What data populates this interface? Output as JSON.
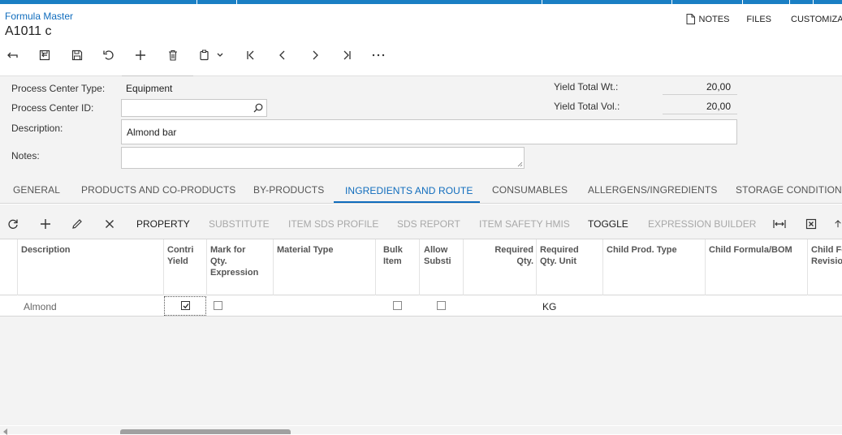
{
  "header": {
    "breadcrumb": "Formula Master",
    "title": "A1011 c",
    "links": {
      "notes": "NOTES",
      "files": "FILES",
      "customize": "CUSTOMIZATION"
    }
  },
  "toolbar": {
    "icons": [
      "back-icon",
      "cancel-changes-icon",
      "save-icon",
      "undo-icon",
      "add-icon",
      "delete-icon",
      "copy-paste-icon",
      "first-record-icon",
      "previous-record-icon",
      "next-record-icon",
      "last-record-icon",
      "more-icon"
    ]
  },
  "form": {
    "process_center_type_label": "Process Center Type:",
    "process_center_type_value": "Equipment",
    "process_center_id_label": "Process Center ID:",
    "process_center_id_value": "",
    "description_label": "Description:",
    "description_value": "Almond bar",
    "notes_label": "Notes:",
    "notes_value": "",
    "yield_total_wt_label": "Yield Total Wt.:",
    "yield_total_wt_value": "20,00",
    "yield_total_vol_label": "Yield Total Vol.:",
    "yield_total_vol_value": "20,00"
  },
  "tabs": [
    "GENERAL",
    "PRODUCTS AND CO-PRODUCTS",
    "BY-PRODUCTS",
    "INGREDIENTS AND ROUTE",
    "CONSUMABLES",
    "ALLERGENS/INGREDIENTS",
    "STORAGE CONDITIONS"
  ],
  "active_tab": "INGREDIENTS AND ROUTE",
  "gridbar": {
    "property": "PROPERTY",
    "substitute": "SUBSTITUTE",
    "item_sds_profile": "ITEM SDS PROFILE",
    "sds_report": "SDS REPORT",
    "item_safety_hmis": "ITEM SAFETY HMIS",
    "toggle": "TOGGLE",
    "expression_builder": "EXPRESSION BUILDER"
  },
  "grid": {
    "columns": {
      "description": "Description",
      "contri_yield_1": "Contri",
      "contri_yield_2": "Yield",
      "mark_qty_1": "Mark for",
      "mark_qty_2": "Qty.",
      "mark_qty_3": "Expression",
      "material_type": "Material Type",
      "bulk_item_1": "Bulk",
      "bulk_item_2": "Item",
      "allow_substi_1": "Allow",
      "allow_substi_2": "Substi",
      "required_qty_1": "Required",
      "required_qty_2": "Qty.",
      "required_qty_unit_1": "Required",
      "required_qty_unit_2": "Qty. Unit",
      "child_prod_type": "Child Prod. Type",
      "child_formula_bom": "Child Formula/BOM",
      "child_formula_rev_1": "Child Fo",
      "child_formula_rev_2": "Revisio"
    },
    "rows": [
      {
        "description": "Almond",
        "contri_yield": true,
        "mark_qty": false,
        "material_type": "",
        "bulk_item": false,
        "allow_substi": false,
        "required_qty": "",
        "required_qty_unit": "KG",
        "child_prod_type": "",
        "child_formula_bom": ""
      }
    ]
  },
  "colors": {
    "accent": "#0f6cbd",
    "topbar": "#1a7fc4",
    "panel": "#f3f3f3"
  }
}
